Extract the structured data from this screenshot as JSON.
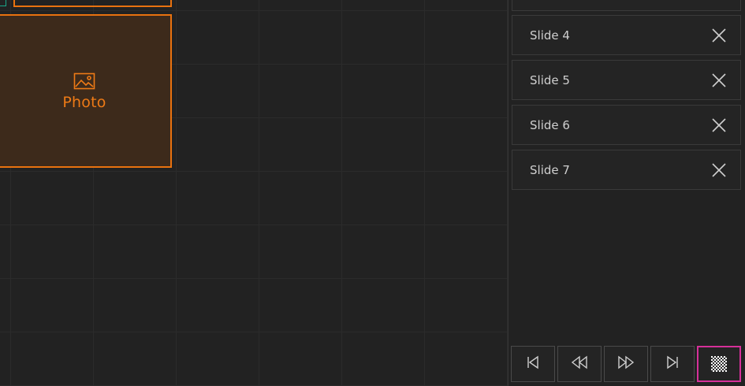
{
  "canvas": {
    "photo_block": {
      "label": "Photo",
      "icon": "image-icon"
    }
  },
  "panel": {
    "slides": [
      {
        "label": "Slide 4",
        "close_icon": "close-icon"
      },
      {
        "label": "Slide 5",
        "close_icon": "close-icon"
      },
      {
        "label": "Slide 6",
        "close_icon": "close-icon"
      },
      {
        "label": "Slide 7",
        "close_icon": "close-icon"
      }
    ],
    "controls": [
      {
        "name": "first",
        "icon": "skip-to-start-icon"
      },
      {
        "name": "previous",
        "icon": "rewind-icon"
      },
      {
        "name": "next",
        "icon": "fast-forward-icon"
      },
      {
        "name": "last",
        "icon": "skip-to-end-icon"
      },
      {
        "name": "transparency",
        "icon": "checkerboard-icon",
        "active": true
      }
    ]
  },
  "colors": {
    "accent_orange": "#e9720f",
    "photo_fill": "#3d2a1b",
    "active_border": "#d6309a",
    "teal_frame": "#19a88a"
  }
}
